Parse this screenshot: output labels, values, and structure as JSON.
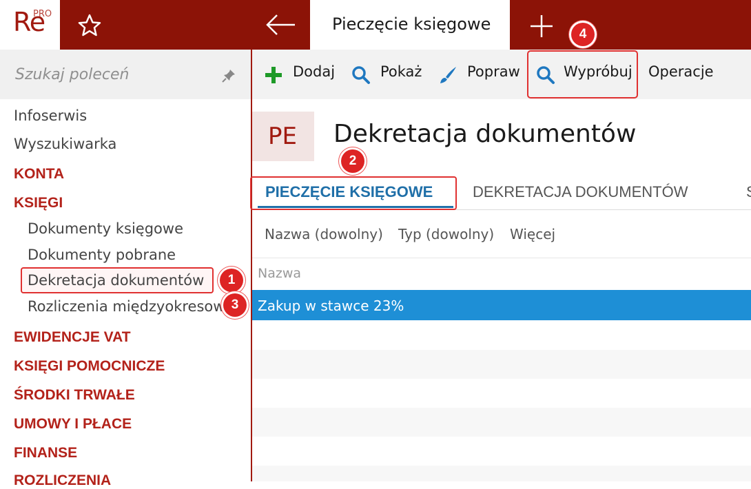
{
  "app": {
    "logo_text": "Re",
    "logo_badge": "PRO",
    "active_tab_label": "Pieczęcie księgowe",
    "brand_color": "#8c1307"
  },
  "sidebar": {
    "search_placeholder": "Szukaj poleceń",
    "items": [
      {
        "label": "Infoserwis"
      },
      {
        "label": "Wyszukiwarka"
      },
      {
        "label": "KONTA"
      },
      {
        "label": "KSIĘGI"
      },
      {
        "label": "Dokumenty księgowe"
      },
      {
        "label": "Dokumenty pobrane"
      },
      {
        "label": "Dekretacja dokumentów"
      },
      {
        "label": "Rozliczenia międzyokresowe"
      },
      {
        "label": "EWIDENCJE VAT"
      },
      {
        "label": "KSIĘGI POMOCNICZE"
      },
      {
        "label": "ŚRODKI TRWAŁE"
      },
      {
        "label": "UMOWY I PŁACE"
      },
      {
        "label": "FINANSE"
      },
      {
        "label": "ROZLICZENIA"
      }
    ]
  },
  "toolbar": {
    "add_label": "Dodaj",
    "show_label": "Pokaż",
    "edit_label": "Popraw",
    "try_label": "Wypróbuj",
    "operations_label": "Operacje"
  },
  "page": {
    "badge": "PE",
    "title": "Dekretacja dokumentów"
  },
  "tabs": [
    {
      "label": "PIECZĘCIE KSIĘGOWE"
    },
    {
      "label": "DEKRETACJA DOKUMENTÓW"
    },
    {
      "label": "S"
    }
  ],
  "filters": [
    {
      "label": "Nazwa (dowolny)"
    },
    {
      "label": "Typ (dowolny)"
    },
    {
      "label": "Więcej"
    }
  ],
  "grid": {
    "column_name": "Nazwa",
    "rows": [
      {
        "name": "Zakup w stawce 23%"
      }
    ]
  },
  "steps": [
    "1",
    "2",
    "3",
    "4"
  ],
  "colors": {
    "accent_red": "#a11a10",
    "selection_blue": "#1e8fd6",
    "tab_blue": "#1f6fa8",
    "step_red": "#dd2424"
  }
}
